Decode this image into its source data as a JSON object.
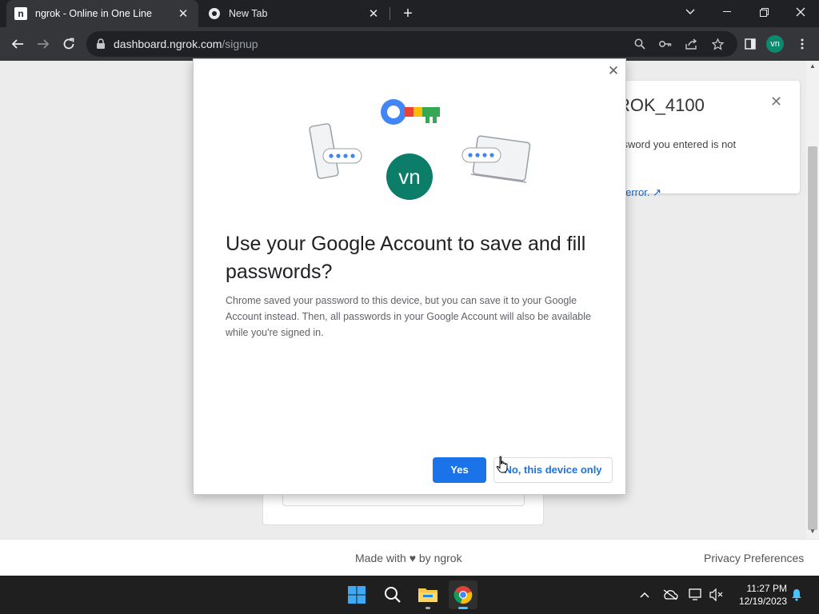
{
  "browser": {
    "tabs": [
      {
        "title": "ngrok - Online in One Line",
        "favicon": "ngrok-icon",
        "active": true
      },
      {
        "title": "New Tab",
        "favicon": "chrome-icon",
        "active": false
      }
    ],
    "url": {
      "host": "dashboard.ngrok.com",
      "path": "/signup"
    },
    "profile_initials": "vn"
  },
  "page": {
    "error": {
      "title": "ROK_4100",
      "message": "ssword you entered is not",
      "link": "s error."
    },
    "footer": {
      "made_with": "Made with ♥ by ngrok",
      "privacy": "Privacy Preferences"
    }
  },
  "dialog": {
    "avatar_initials": "vn",
    "title": "Use your Google Account to save and fill passwords?",
    "body": "Chrome saved your password to this device, but you can save it to your Google Account instead. Then, all passwords in your Google Account will also be available while you're signed in.",
    "yes_label": "Yes",
    "no_label": "No, this device only"
  },
  "taskbar": {
    "time": "11:27 PM",
    "date": "12/19/2023"
  },
  "colors": {
    "accent": "#1a73e8",
    "avatar": "#0b7d68"
  }
}
